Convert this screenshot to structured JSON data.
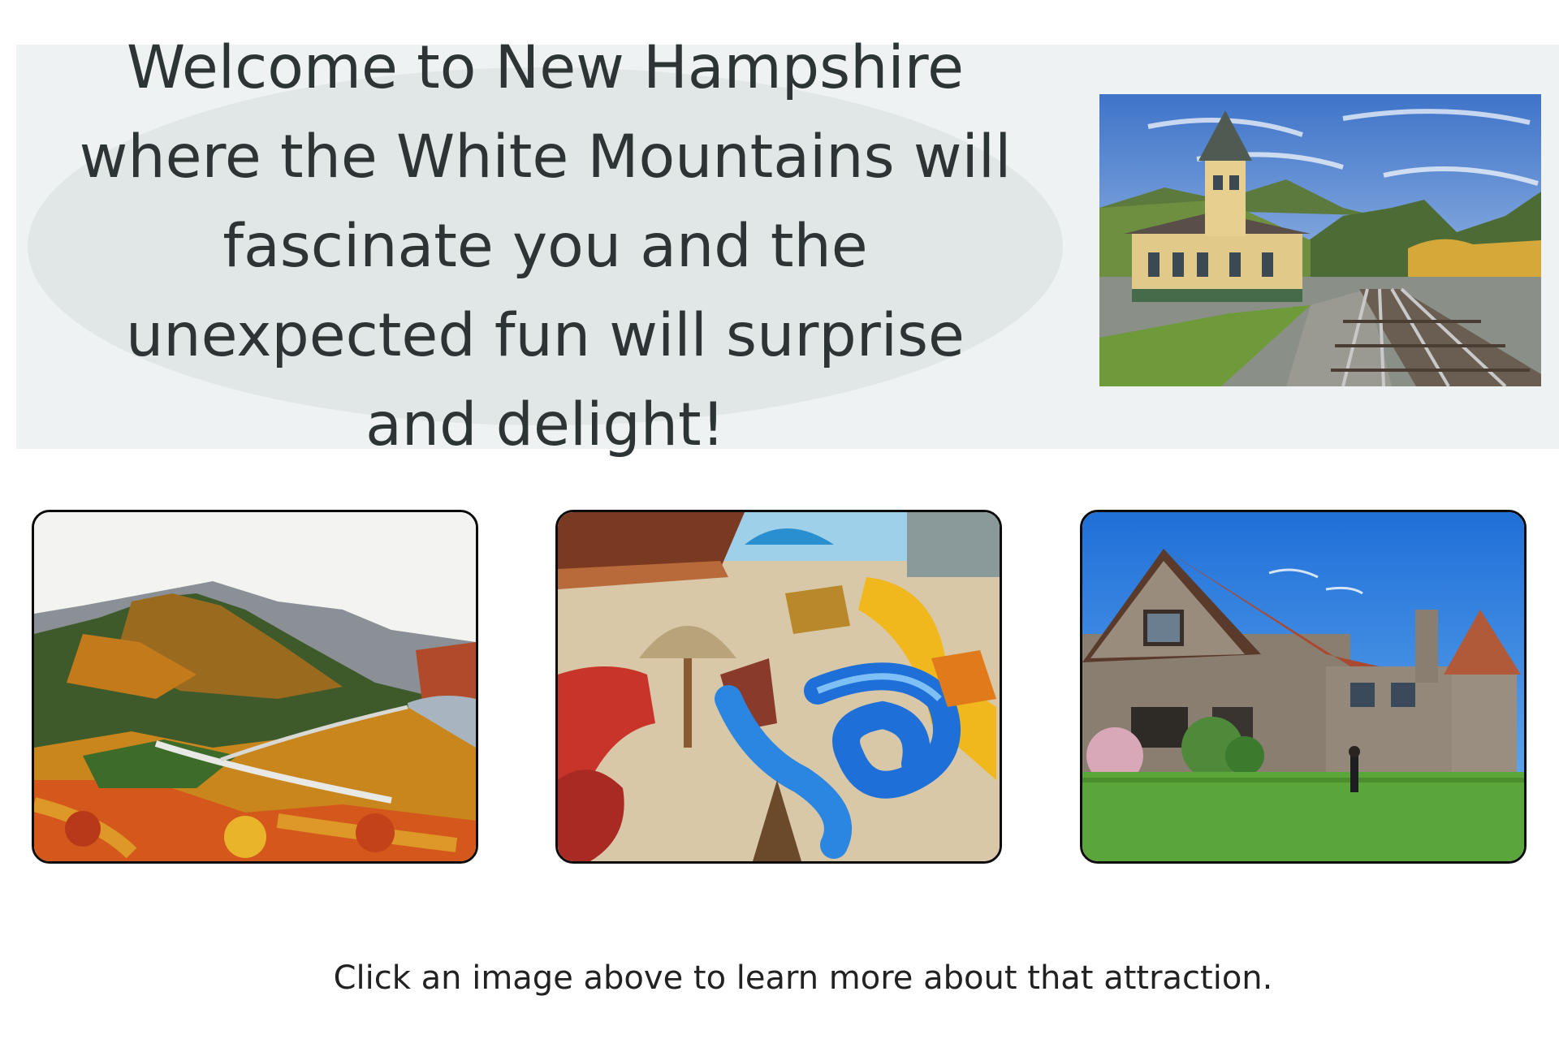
{
  "hero": {
    "headline": "Welcome to New Hampshire where the White Mountains will fascinate you and the unexpected fun will surprise and delight!",
    "photo": "mountain railway station with train tracks under blue sky"
  },
  "attractions": [
    {
      "photo": "autumn mountain notch with highway and lake"
    },
    {
      "photo": "colorful water park slides"
    },
    {
      "photo": "stone tudor-style castle with lawn"
    }
  ],
  "caption": "Click an image above to learn more about that attraction.",
  "colors": {
    "hero_background": "#eef2f2",
    "hero_bubble": "#e1e7e7",
    "headline_text": "#2d3436",
    "card_border": "#0c0c0c"
  }
}
